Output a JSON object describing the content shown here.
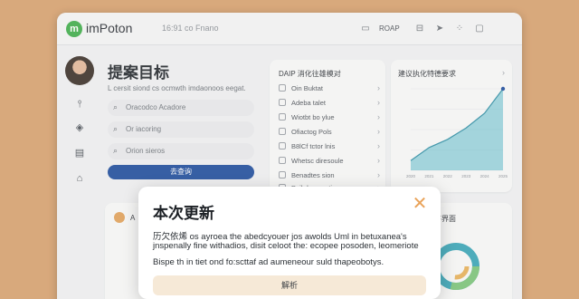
{
  "app": {
    "logo_letter": "m",
    "name": "imPoton",
    "status_text": "16:91 co Fnano",
    "top_label": "ROAP"
  },
  "icons": {
    "top": [
      "chat-bubble-icon",
      "inbox-icon",
      "send-icon",
      "grid-icon",
      "square-icon"
    ],
    "nav": [
      "pin-icon",
      "cube-icon",
      "document-icon",
      "home-icon"
    ]
  },
  "main": {
    "title": "提案目标",
    "subtitle": "L cersit siond cs ocmwth imdaonoos eegat.",
    "fields": [
      "Oracodco Acadore",
      "Or iacoring",
      "Orion sieros"
    ],
    "primary_button": "去查询"
  },
  "list_card": {
    "title": "DAIP 消化往雄模对",
    "items": [
      "Oin Buktat",
      "Adeba talet",
      "Wiotbt bo ylue",
      "Ofiactog Pols",
      "B8lCf tctor lnis",
      "Whetsc diresoule",
      "Benadtes sion",
      "Dsib lemasation"
    ]
  },
  "chart_card": {
    "title": "建议执化特德要求"
  },
  "chart_data": {
    "type": "area",
    "title": "建议执化特德要求",
    "xlabel": "",
    "ylabel": "",
    "x": [
      "2020",
      "2021",
      "2022",
      "2023",
      "2024",
      "2025"
    ],
    "values": [
      12,
      28,
      38,
      52,
      70,
      100
    ],
    "ylim": [
      0,
      100
    ],
    "grid": true,
    "color": "#4fb6c6"
  },
  "bottom_cards": {
    "left_label": "A",
    "right_title": "序界面"
  },
  "modal": {
    "title": "本次更新",
    "lines": [
      "历欠依烯   os ayroea the abedcyouer jos awolds Uml in betuxanea's",
      "jnspenally  fine withadios, disit celoot the: ecopee posoden, leomeriote",
      "Bispe th in tiet ond fo:scttaf ad aumeneour suld thapeobotys."
    ],
    "button": "解析"
  }
}
